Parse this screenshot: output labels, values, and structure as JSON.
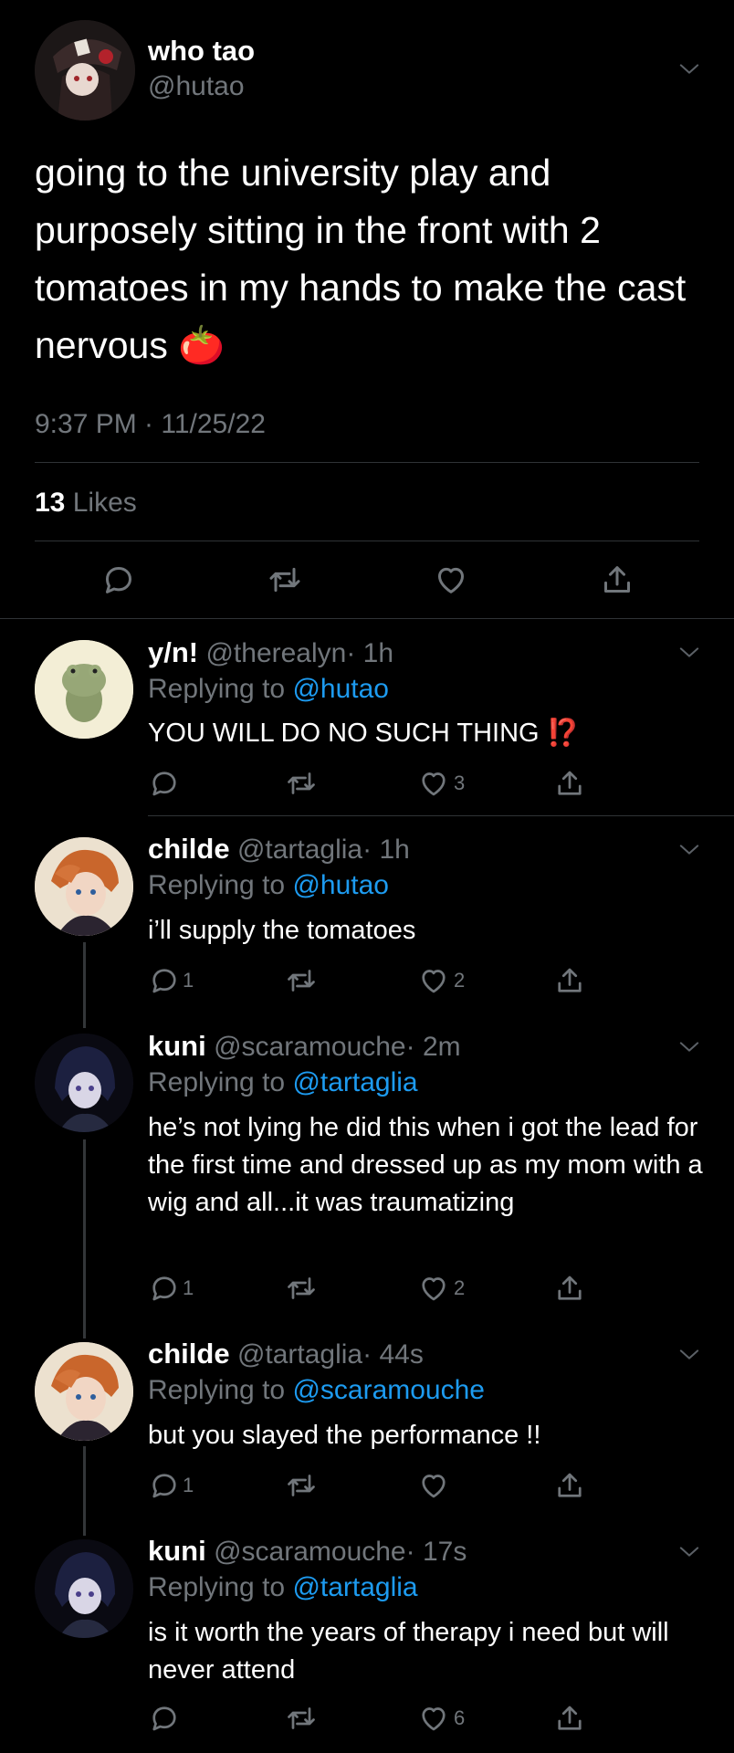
{
  "main_tweet": {
    "display_name": "who tao",
    "handle": "@hutao",
    "text": "going to the university play and purposely sitting in the front with 2 tomatoes in my hands to make the cast nervous",
    "emoji": "🍅",
    "timestamp": "9:37 PM · 11/25/22",
    "likes_count": "13",
    "likes_label": "Likes"
  },
  "replies": [
    {
      "display_name": "y/n!",
      "handle": "@therealyn",
      "time": "· 1h",
      "replying_prefix": "Replying to",
      "replying_to": "@hutao",
      "text": "YOU WILL DO NO SUCH THING",
      "emoji": "⁉️",
      "reply_count": "",
      "like_count": "3"
    },
    {
      "display_name": "childe",
      "handle": "@tartaglia",
      "time": "· 1h",
      "replying_prefix": "Replying to",
      "replying_to": "@hutao",
      "text": "i’ll supply the tomatoes",
      "reply_count": "1",
      "like_count": "2"
    },
    {
      "display_name": "kuni",
      "handle": "@scaramouche",
      "time": "· 2m",
      "replying_prefix": "Replying to",
      "replying_to": "@tartaglia",
      "text": "he’s not lying he did this when i got the lead for the first time and dressed up as my mom with a wig and all...it was traumatizing",
      "reply_count": "1",
      "like_count": "2"
    },
    {
      "display_name": "childe",
      "handle": "@tartaglia",
      "time": "· 44s",
      "replying_prefix": "Replying to",
      "replying_to": "@scaramouche",
      "text": "but you slayed the performance !!",
      "reply_count": "1",
      "like_count": ""
    },
    {
      "display_name": "kuni",
      "handle": "@scaramouche",
      "time": "· 17s",
      "replying_prefix": "Replying to",
      "replying_to": "@tartaglia",
      "text": "is it worth the years of therapy i need but will never attend",
      "reply_count": "",
      "like_count": "6"
    }
  ],
  "icons": {
    "reply": "reply-icon",
    "retweet": "retweet-icon",
    "like": "heart-icon",
    "share": "share-icon",
    "more": "chevron-down-icon"
  },
  "colors": {
    "background": "#000000",
    "muted": "#71767b",
    "link": "#1d9bf0",
    "divider": "#2f3336"
  }
}
